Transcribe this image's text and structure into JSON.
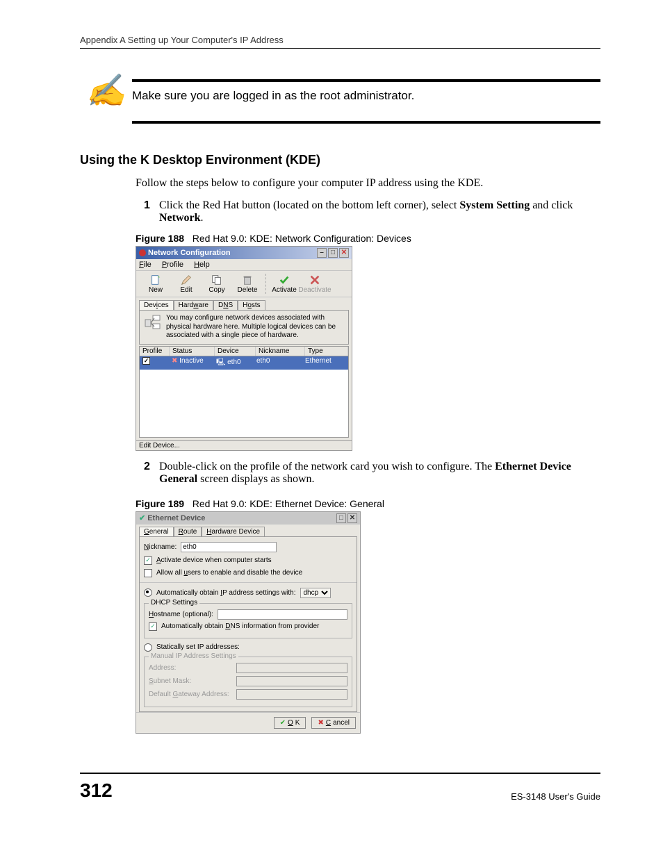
{
  "header": {
    "text": "Appendix A Setting up Your Computer's IP Address"
  },
  "note": {
    "text": "Make sure you are logged in as the root administrator."
  },
  "section_heading": "Using the K Desktop Environment (KDE)",
  "intro": "Follow the steps below to configure your computer IP address using the KDE.",
  "step1": {
    "num": "1",
    "pre": "Click the Red Hat button (located on the bottom left corner), select ",
    "bold1": "System Setting",
    "mid": " and click ",
    "bold2": "Network",
    "post": "."
  },
  "fig188": {
    "label": "Figure 188",
    "caption": "Red Hat 9.0: KDE: Network Configuration: Devices"
  },
  "win1": {
    "title": "Network Configuration",
    "menu": {
      "file": "File",
      "profile": "Profile",
      "help": "Help"
    },
    "toolbar": {
      "new": "New",
      "edit": "Edit",
      "copy": "Copy",
      "delete": "Delete",
      "activate": "Activate",
      "deactivate": "Deactivate"
    },
    "tabs": {
      "devices": "Devices",
      "hardware": "Hardware",
      "dns": "DNS",
      "hosts": "Hosts"
    },
    "info": "You may configure network devices associated with physical hardware here.  Multiple logical devices can be associated with a single piece of hardware.",
    "cols": {
      "profile": "Profile",
      "status": "Status",
      "device": "Device",
      "nickname": "Nickname",
      "type": "Type"
    },
    "row": {
      "check": "✓",
      "status": "Inactive",
      "device": "eth0",
      "nickname": "eth0",
      "type": "Ethernet"
    },
    "statusbar": "Edit Device..."
  },
  "step2": {
    "num": "2",
    "pre": "Double-click on the profile of the network card you wish to configure. The ",
    "bold1": "Ethernet Device General",
    "post": " screen displays as shown."
  },
  "fig189": {
    "label": "Figure 189",
    "caption": "Red Hat 9.0: KDE: Ethernet Device: General"
  },
  "win2": {
    "title": "Ethernet Device",
    "tabs": {
      "general": "General",
      "route": "Route",
      "hw": "Hardware Device"
    },
    "nickname_label": "Nickname:",
    "nickname_value": "eth0",
    "activate": "Activate device when computer starts",
    "allow": "Allow all users to enable and disable the device",
    "auto_ip": "Automatically obtain IP address settings with:",
    "dhcp_option": "dhcp",
    "dhcp_legend": "DHCP Settings",
    "hostname_label": "Hostname (optional):",
    "auto_dns": "Automatically obtain DNS information from provider",
    "static_label": "Statically set IP addresses:",
    "manual_legend": "Manual IP Address Settings",
    "address_label": "Address:",
    "subnet_label": "Subnet Mask:",
    "gateway_label": "Default Gateway Address:",
    "ok": "OK",
    "cancel": "Cancel"
  },
  "footer": {
    "page": "312",
    "guide": "ES-3148 User's Guide"
  }
}
